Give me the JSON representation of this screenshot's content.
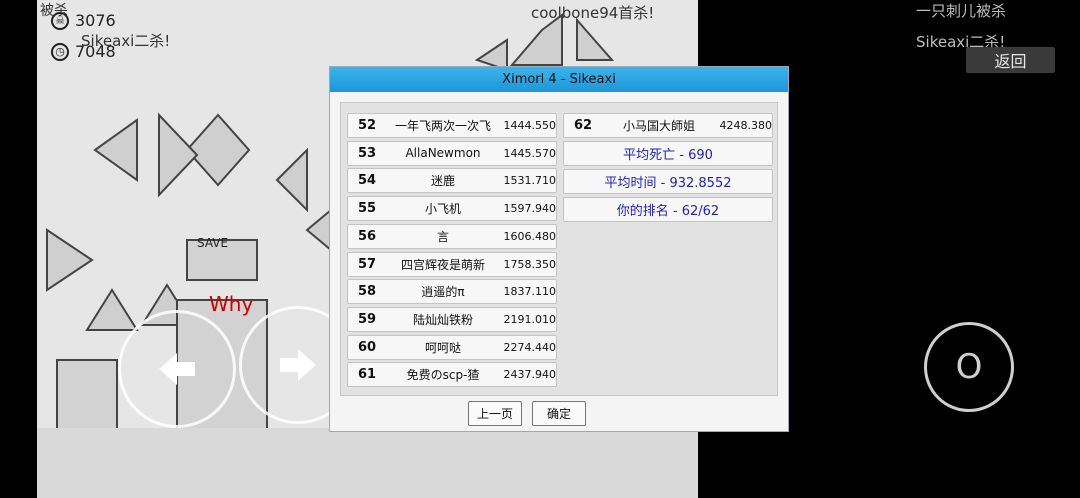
{
  "hud": {
    "top_text": "被杀",
    "deaths": "3076",
    "kill_notice": "Sikeaxi二杀!",
    "time": "7048",
    "top_kill": "coolbone94首杀!",
    "why_text": "Why",
    "save_text": "SAVE"
  },
  "side_messages": [
    "一只刺儿被杀",
    "Sikeaxi二杀!"
  ],
  "back_label": "返回",
  "o_label": "O",
  "dialog": {
    "title": "Ximorl 4 - Sikeaxi",
    "ranks": [
      {
        "rank": "52",
        "name": "一年飞两次一次飞",
        "time": "1444.550"
      },
      {
        "rank": "53",
        "name": "AllaNewmon",
        "time": "1445.570"
      },
      {
        "rank": "54",
        "name": "迷鹿",
        "time": "1531.710"
      },
      {
        "rank": "55",
        "name": "小飞机",
        "time": "1597.940"
      },
      {
        "rank": "56",
        "name": "言",
        "time": "1606.480"
      },
      {
        "rank": "57",
        "name": "四宫辉夜是萌新",
        "time": "1758.350"
      },
      {
        "rank": "58",
        "name": "逍遥的π",
        "time": "1837.110"
      },
      {
        "rank": "59",
        "name": "陆灿灿铁粉",
        "time": "2191.010"
      },
      {
        "rank": "60",
        "name": "呵呵哒",
        "time": "2274.440"
      },
      {
        "rank": "61",
        "name": "免费のscp-猹",
        "time": "2437.940"
      }
    ],
    "right_rank": {
      "rank": "62",
      "name": "小马国大師姐",
      "time": "4248.380"
    },
    "stats": [
      "平均死亡 - 690",
      "平均时间 - 932.8552",
      "你的排名 - 62/62"
    ],
    "prev_label": "上一页",
    "ok_label": "确定"
  }
}
